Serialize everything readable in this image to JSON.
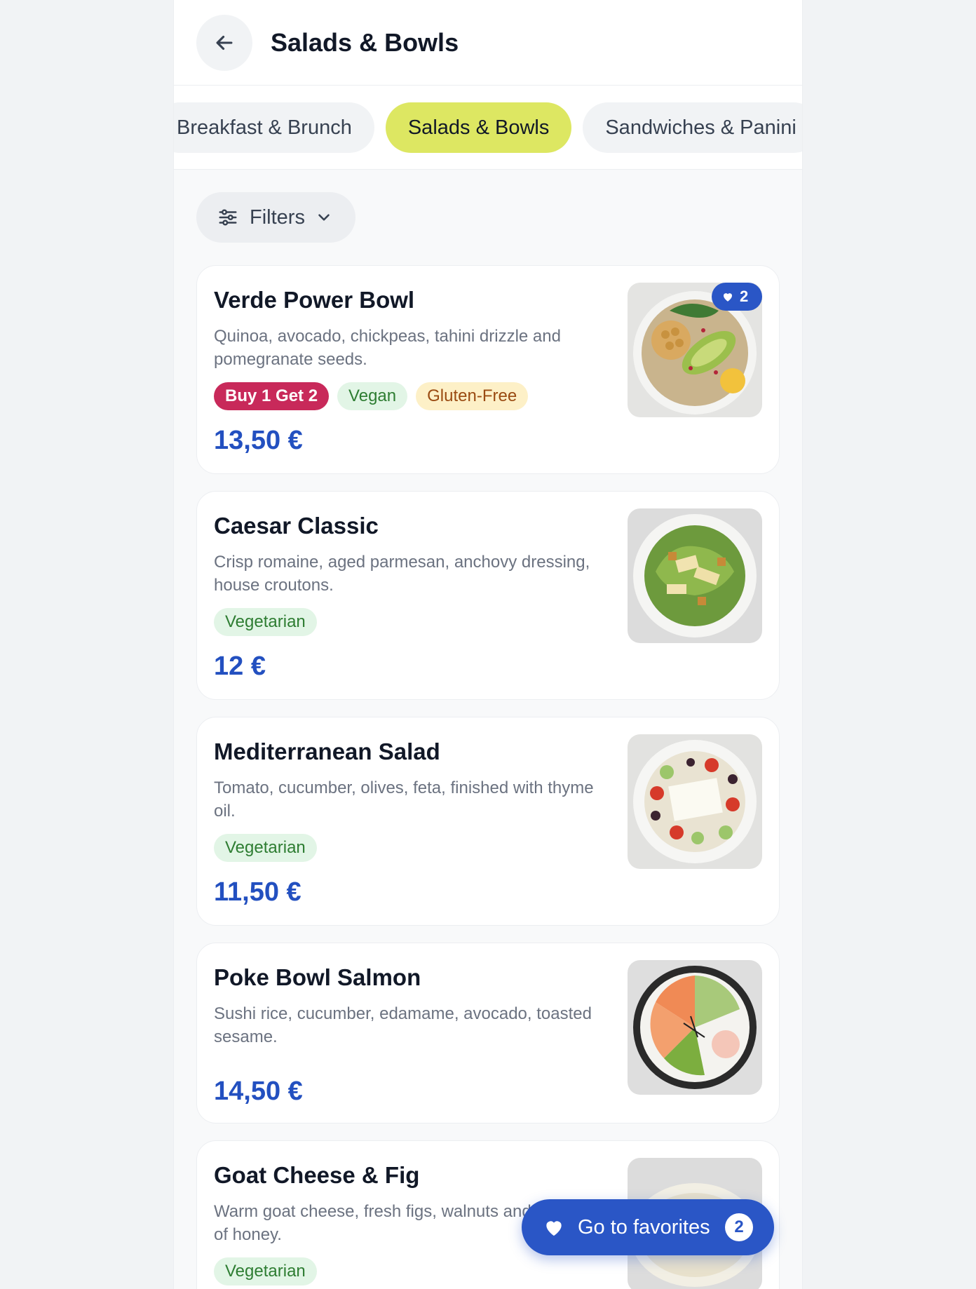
{
  "header": {
    "title": "Salads & Bowls"
  },
  "tabs": [
    {
      "label": "Breakfast & Brunch",
      "active": false
    },
    {
      "label": "Salads & Bowls",
      "active": true
    },
    {
      "label": "Sandwiches & Panini",
      "active": false
    }
  ],
  "filters": {
    "label": "Filters"
  },
  "items": [
    {
      "title": "Verde Power Bowl",
      "description": "Quinoa, avocado, chickpeas, tahini drizzle and pomegranate seeds.",
      "tags": [
        {
          "label": "Buy 1 Get 2",
          "kind": "promo"
        },
        {
          "label": "Vegan",
          "kind": "green"
        },
        {
          "label": "Gluten-Free",
          "kind": "amber"
        }
      ],
      "price": "13,50 €",
      "favorites": "2",
      "image": "quinoa-avocado-bowl"
    },
    {
      "title": "Caesar Classic",
      "description": "Crisp romaine, aged parmesan, anchovy dressing, house croutons.",
      "tags": [
        {
          "label": "Vegetarian",
          "kind": "green"
        }
      ],
      "price": "12 €",
      "image": "caesar-salad"
    },
    {
      "title": "Mediterranean Salad",
      "description": "Tomato, cucumber, olives, feta, finished with thyme oil.",
      "tags": [
        {
          "label": "Vegetarian",
          "kind": "green"
        }
      ],
      "price": "11,50 €",
      "image": "greek-salad"
    },
    {
      "title": "Poke Bowl Salmon",
      "description": "Sushi rice, cucumber, edamame, avocado, toasted sesame.",
      "tags": [],
      "price": "14,50 €",
      "image": "salmon-poke-bowl"
    },
    {
      "title": "Goat Cheese & Fig",
      "description": "Warm goat cheese, fresh figs, walnuts and a drizzle of honey.",
      "tags": [
        {
          "label": "Vegetarian",
          "kind": "green"
        }
      ],
      "price": "",
      "image": "goat-cheese-fig-salad"
    }
  ],
  "fab": {
    "label": "Go to favorites",
    "count": "2"
  },
  "colors": {
    "accent": "#2a56c6",
    "active_tab": "#dde762",
    "price": "#2350c0",
    "promo": "#c8295a"
  },
  "icons": {
    "back": "arrow-left-icon",
    "filters": "sliders-icon",
    "chevron": "chevron-down-icon",
    "heart": "heart-icon"
  }
}
